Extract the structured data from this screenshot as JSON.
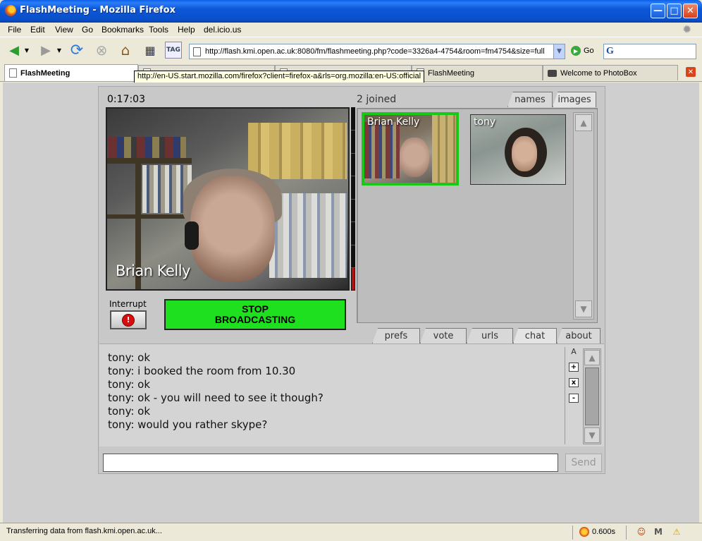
{
  "window": {
    "title": "FlashMeeting - Mozilla Firefox"
  },
  "menu": {
    "items": [
      "File",
      "Edit",
      "View",
      "Go",
      "Bookmarks",
      "Tools",
      "Help",
      "del.icio.us"
    ]
  },
  "toolbar": {
    "url": "http://flash.kmi.open.ac.uk:8080/fm/flashmeeting.php?code=3326a4-4754&room=fm4754&size=full",
    "go_label": "Go",
    "search_logo": "G",
    "tag_label": "TAG"
  },
  "tabs": [
    {
      "label": "FlashMeeting",
      "active": true
    },
    {
      "label": "",
      "active": false
    },
    {
      "label": "",
      "active": false
    },
    {
      "label": "FlashMeeting",
      "active": false
    },
    {
      "label": "Welcome to PhotoBox",
      "active": false
    }
  ],
  "tooltip": "http://en-US.start.mozilla.com/firefox?client=firefox-a&rls=org.mozilla:en-US:official",
  "meeting": {
    "timer": "0:17:03",
    "joined": "2 joined",
    "view_tabs": [
      "names",
      "images"
    ],
    "active_view_tab": "images",
    "main_video_label": "Brian Kelly",
    "audio_level": 0.12,
    "interrupt_label": "Interrupt",
    "stop_label_line1": "STOP",
    "stop_label_line2": "BROADCASTING",
    "participants": [
      {
        "name": "Brian Kelly",
        "broadcasting": true
      },
      {
        "name": "tony",
        "broadcasting": false
      }
    ],
    "bottom_tabs": [
      "prefs",
      "vote",
      "urls",
      "chat",
      "about"
    ],
    "active_bottom_tab": "chat",
    "font_label": "A",
    "font_plus": "+",
    "font_reset": "x",
    "font_minus": "-",
    "chat": [
      "tony: ok",
      "tony: i booked the room from 10.30",
      "tony: ok",
      "tony: ok - you will need to see it though?",
      "tony: ok",
      "tony: would you rather skype?"
    ],
    "chat_input_value": "",
    "send_label": "Send"
  },
  "status": {
    "text": "Transferring data from flash.kmi.open.ac.uk...",
    "timing": "0.600s"
  },
  "colors": {
    "broadcast_green": "#1ee01e",
    "thumb_border_active": "#18c918",
    "xp_blue": "#0a4fc9"
  }
}
